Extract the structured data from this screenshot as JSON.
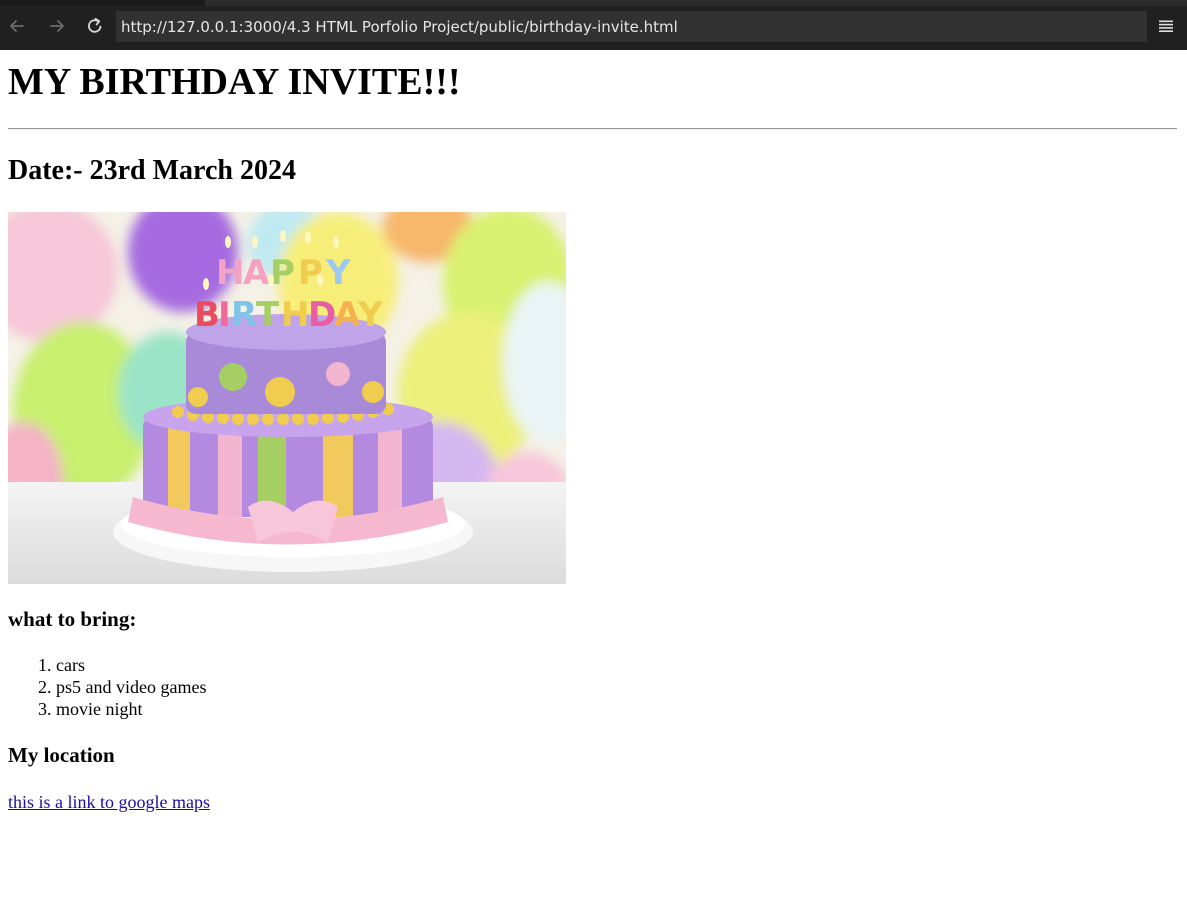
{
  "browser": {
    "url": "http://127.0.0.1:3000/4.3 HTML Porfolio Project/public/birthday-invite.html",
    "back_icon": "arrow-left-icon",
    "forward_icon": "arrow-right-icon",
    "reload_icon": "reload-icon",
    "menu_icon": "hamburger-menu-icon"
  },
  "page": {
    "title": "MY BIRTHDAY INVITE!!!",
    "date": "Date:- 23rd March 2024",
    "image": {
      "subject": "birthday cake with happy birthday candles and balloons"
    },
    "bring_heading": "what to bring:",
    "bring_items": [
      "cars",
      "ps5 and video games",
      "movie night"
    ],
    "location_heading": "My location",
    "location_link": "this is a link to google maps"
  },
  "colors": {
    "chrome_bg": "#202020",
    "url_bg": "#323232",
    "link": "#1a0dab"
  }
}
